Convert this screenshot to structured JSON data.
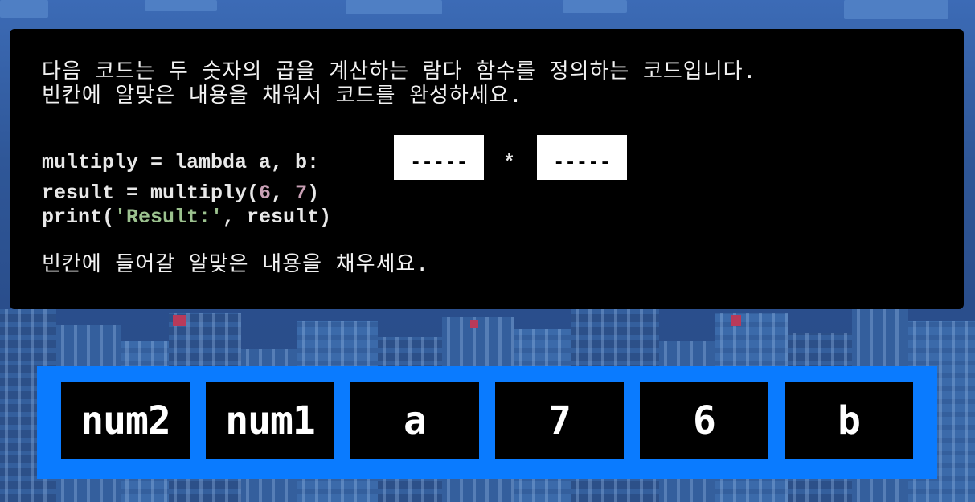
{
  "question": {
    "line1": "다음 코드는 두 숫자의 곱을 계산하는 람다 함수를 정의하는 코드입니다.",
    "line2": "빈칸에 알맞은 내용을 채워서 코드를 완성하세요.",
    "instruction": "빈칸에 들어갈 알맞은 내용을 채우세요."
  },
  "code": {
    "line1_prefix": "multiply = lambda a, b:",
    "operator": "*",
    "line2_a": "result = multiply(",
    "line2_n1": "6",
    "line2_sep": ", ",
    "line2_n2": "7",
    "line2_close": ")",
    "line3_a": "print(",
    "line3_str": "'Result:'",
    "line3_b": ", result)"
  },
  "blanks": [
    "-----",
    "-----"
  ],
  "options": [
    "num2",
    "num1",
    "a",
    "7",
    "6",
    "b"
  ],
  "colors": {
    "tray": "#0a7bff",
    "panel": "#000000",
    "number": "#c9a0b5",
    "string": "#9cc28f"
  }
}
